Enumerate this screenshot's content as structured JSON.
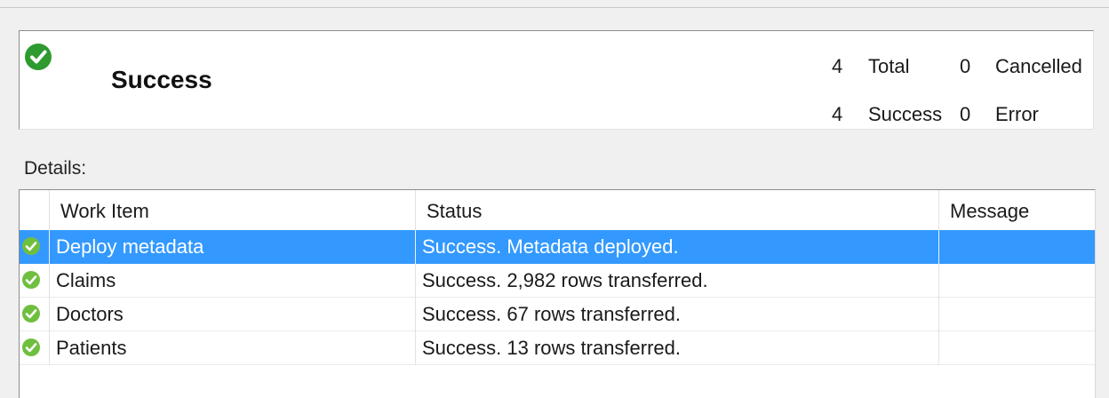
{
  "summary": {
    "title": "Success",
    "icon": "success-check-icon",
    "accent_color": "#2f9a2f",
    "total_count": "4",
    "total_label": "Total",
    "cancelled_count": "0",
    "cancelled_label": "Cancelled",
    "success_count": "4",
    "success_label": "Success",
    "error_count": "0",
    "error_label": "Error"
  },
  "details": {
    "label": "Details:",
    "columns": [
      "Work Item",
      "Status",
      "Message"
    ],
    "selected_row_color": "#3399ff",
    "rows": [
      {
        "icon": "success-check-icon",
        "work_item": "Deploy metadata",
        "status": "Success. Metadata deployed.",
        "message": "",
        "selected": true
      },
      {
        "icon": "success-check-icon",
        "work_item": "Claims",
        "status": "Success. 2,982 rows transferred.",
        "message": "",
        "selected": false
      },
      {
        "icon": "success-check-icon",
        "work_item": "Doctors",
        "status": "Success. 67 rows transferred.",
        "message": "",
        "selected": false
      },
      {
        "icon": "success-check-icon",
        "work_item": "Patients",
        "status": "Success. 13 rows transferred.",
        "message": "",
        "selected": false
      }
    ]
  }
}
